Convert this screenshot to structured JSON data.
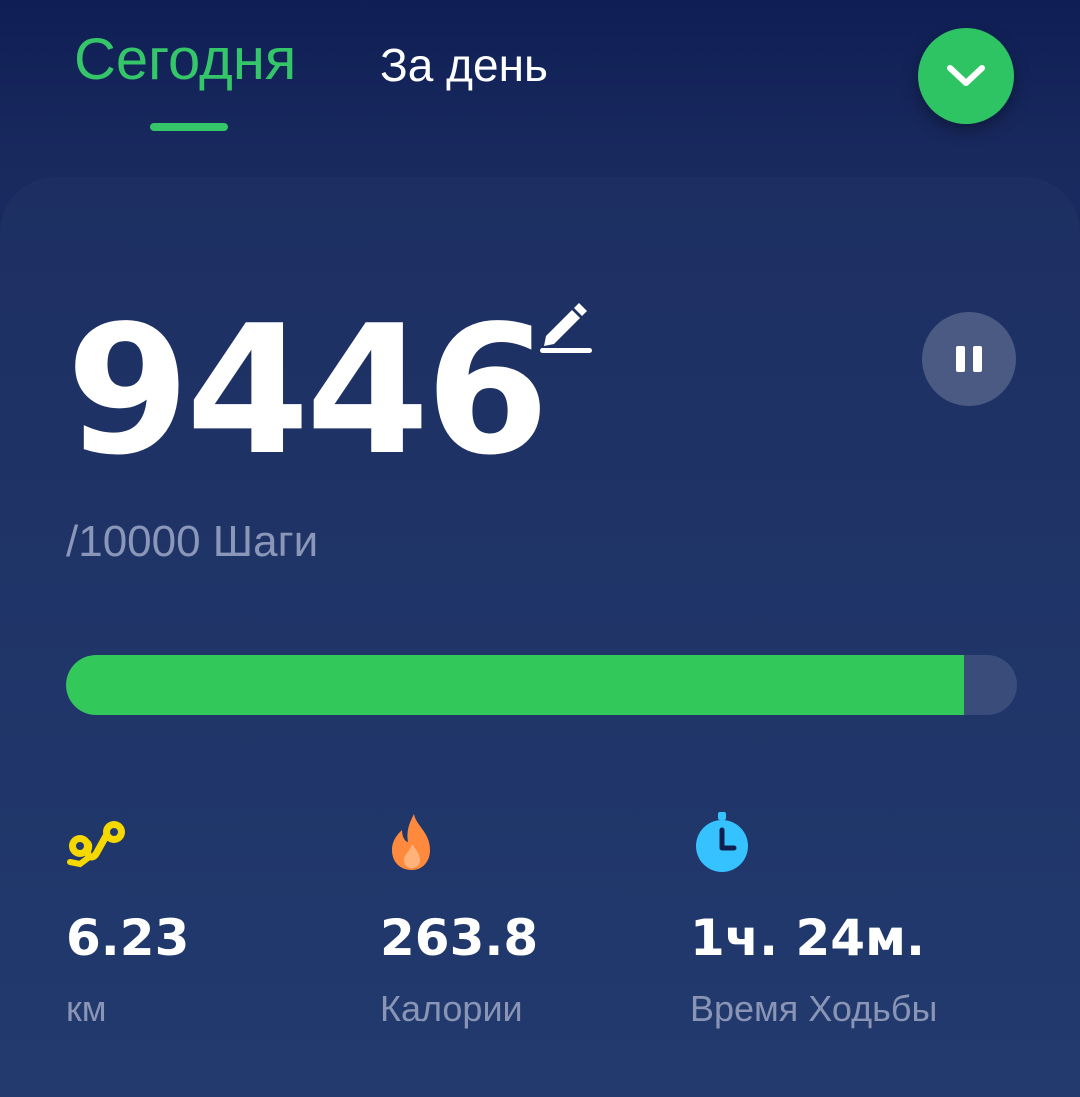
{
  "tabs": [
    {
      "label": "Сегодня",
      "active": true
    },
    {
      "label": "За день",
      "active": false
    }
  ],
  "accent_color": "#34c668",
  "collapse_icon": "chevron-down-icon",
  "steps": {
    "value": "9446",
    "goal_text": "/10000 Шаги",
    "progress_fraction": 0.9446
  },
  "controls": {
    "edit_icon": "pencil-icon",
    "pause_icon": "pause-icon"
  },
  "stats": [
    {
      "icon": "route-icon",
      "icon_color": "#f5d800",
      "value": "6.23",
      "label": "км"
    },
    {
      "icon": "flame-icon",
      "icon_color": "#ff8a3d",
      "value": "263.8",
      "label": "Калории"
    },
    {
      "icon": "stopwatch-icon",
      "icon_color": "#35c2ff",
      "value": "1ч. 24м.",
      "label": "Время Ходьбы"
    }
  ]
}
